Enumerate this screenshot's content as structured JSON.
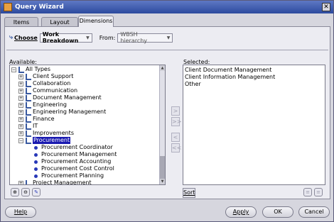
{
  "window": {
    "title": "Query Wizard",
    "close_glyph": "✕"
  },
  "tabs": [
    {
      "label": "Items"
    },
    {
      "label": "Layout"
    },
    {
      "label": "Dimensions"
    }
  ],
  "choose": {
    "label": "Choose",
    "value": "Work Breakdown"
  },
  "from": {
    "label": "From:",
    "value": "WBSH hierarchy"
  },
  "available": {
    "label": "Available:",
    "root": "All Types",
    "items": [
      {
        "label": "Client Support",
        "kind": "dimension"
      },
      {
        "label": "Collaboration",
        "kind": "dimension"
      },
      {
        "label": "Communication",
        "kind": "dimension"
      },
      {
        "label": "Document Management",
        "kind": "dimension"
      },
      {
        "label": "Engineering",
        "kind": "dimension"
      },
      {
        "label": "Engineering Management",
        "kind": "dimension"
      },
      {
        "label": "Finance",
        "kind": "dimension"
      },
      {
        "label": "IT",
        "kind": "dimension"
      },
      {
        "label": "Improvements",
        "kind": "dimension"
      },
      {
        "label": "Procurement",
        "kind": "dimension-selected"
      },
      {
        "label": "Procurement Coordinator",
        "kind": "member"
      },
      {
        "label": "Procurement Management",
        "kind": "member"
      },
      {
        "label": "Procurement Accounting",
        "kind": "member"
      },
      {
        "label": "Procurement Cost Control",
        "kind": "member"
      },
      {
        "label": "Procurement Planning",
        "kind": "member"
      },
      {
        "label": "Project Management",
        "kind": "dimension"
      }
    ]
  },
  "selected": {
    "label": "Selected:",
    "items": [
      "Client Document Management",
      "Client Information Management",
      "Other"
    ]
  },
  "move_buttons": [
    ">",
    ">>",
    "<",
    "<<"
  ],
  "sort_label": "Sort",
  "buttons": {
    "help": "Help",
    "apply": "Apply",
    "ok": "OK",
    "cancel": "Cancel"
  },
  "colors": {
    "titlebar": "#2c4a9e",
    "selection": "#1a1ab0",
    "member_dot": "#2838b8"
  }
}
